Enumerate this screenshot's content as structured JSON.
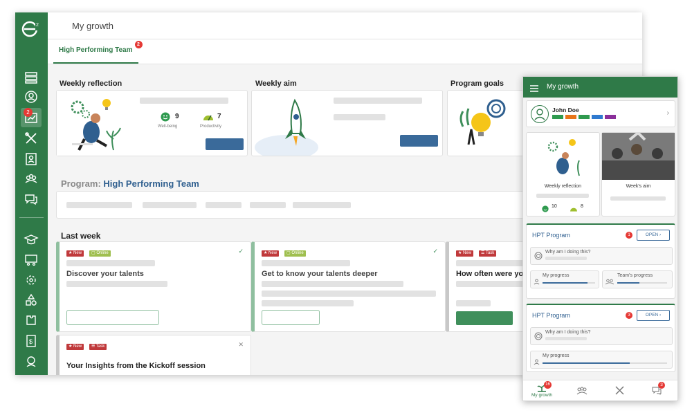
{
  "app": {
    "title": "My growth",
    "tab": "High Performing Team",
    "tab_badge": "2",
    "nav_badge": "2"
  },
  "sections": {
    "weekly_reflection": "Weekly reflection",
    "weekly_aim": "Weekly aim",
    "program_goals": "Program goals",
    "program_prefix": "Program:",
    "program_name": "High Performing Team",
    "last_week": "Last week"
  },
  "reflection_stats": {
    "wellbeing_value": "9",
    "wellbeing_label": "Well-being",
    "productivity_value": "7",
    "productivity_label": "Productivity"
  },
  "tags": {
    "new": "New",
    "online": "Online",
    "task": "Task"
  },
  "last_week": {
    "card1_title": "Discover your talents",
    "card2_title": "Get to know your talents deeper",
    "card3_title": "How often were yo",
    "card4_title": "Your Insights from the Kickoff session"
  },
  "icons": {
    "check": "✓",
    "close": "✕"
  },
  "mobile": {
    "title": "My growth",
    "user_name": "John Doe",
    "user_colors": [
      "#2f9a4f",
      "#e8751a",
      "#2f9a4f",
      "#2f7acf",
      "#8a2f9a"
    ],
    "weekly_reflection": "Weekly reflection",
    "weekly_aim": "Week's aim",
    "wellbeing": "10",
    "productivity": "8",
    "program1": {
      "title": "HPT Program",
      "badge": "1",
      "open": "OPEN ›",
      "why": "Why am I doing this?",
      "my_progress": "My progress",
      "team_progress": "Team's progress",
      "my_progress_value": 0.85,
      "team_progress_value": 0.45
    },
    "program2": {
      "title": "HPT Program",
      "badge": "3",
      "open": "OPEN ›",
      "why": "Why am I doing this?",
      "my_progress": "My progress",
      "my_progress_value": 0.7
    },
    "nav": {
      "growth": "My growth",
      "growth_badge": "16",
      "chat_badge": "3"
    }
  }
}
